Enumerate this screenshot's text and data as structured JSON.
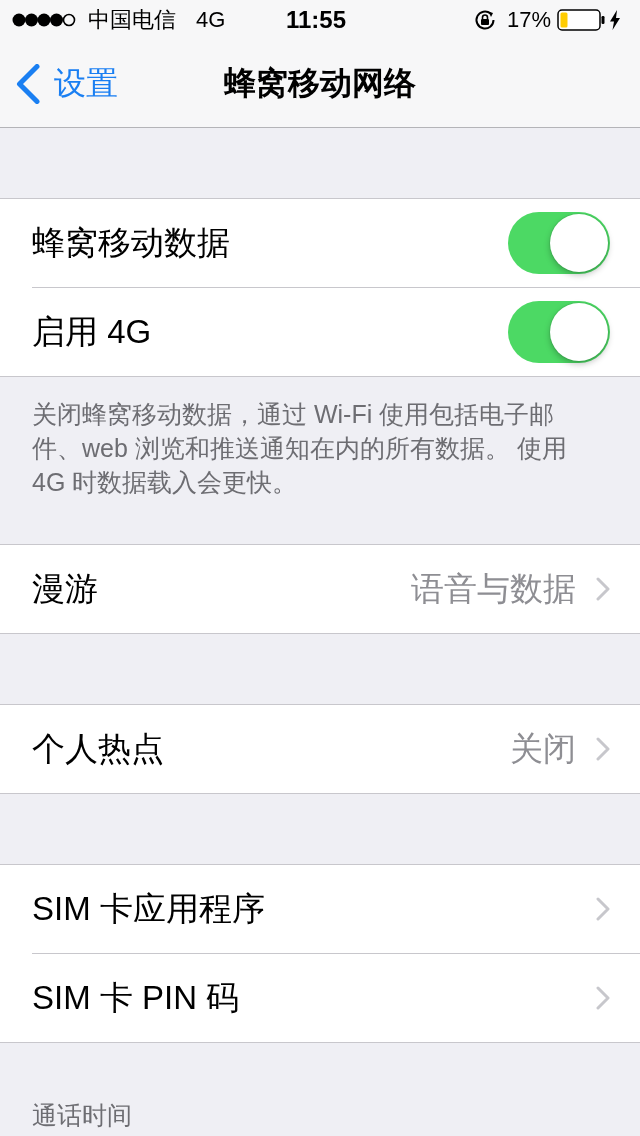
{
  "status_bar": {
    "carrier": "中国电信",
    "network": "4G",
    "time": "11:55",
    "battery": "17%"
  },
  "nav_bar": {
    "back": "设置",
    "title": "蜂窝移动网络"
  },
  "groups": [
    {
      "rows": [
        {
          "kind": "toggle",
          "label": "蜂窝移动数据",
          "on": true
        },
        {
          "kind": "toggle",
          "label": "启用 4G",
          "on": true
        }
      ],
      "footer": "关闭蜂窝移动数据，通过 Wi-Fi 使用包括电子邮件、web 浏览和推送通知在内的所有数据。 使用 4G 时数据载入会更快。"
    },
    {
      "rows": [
        {
          "kind": "link",
          "label": "漫游",
          "value": "语音与数据"
        }
      ]
    },
    {
      "rows": [
        {
          "kind": "link",
          "label": "个人热点",
          "value": "关闭"
        }
      ]
    },
    {
      "rows": [
        {
          "kind": "link",
          "label": "SIM 卡应用程序"
        },
        {
          "kind": "link",
          "label": "SIM 卡 PIN 码"
        }
      ]
    },
    {
      "header": "通话时间"
    }
  ]
}
